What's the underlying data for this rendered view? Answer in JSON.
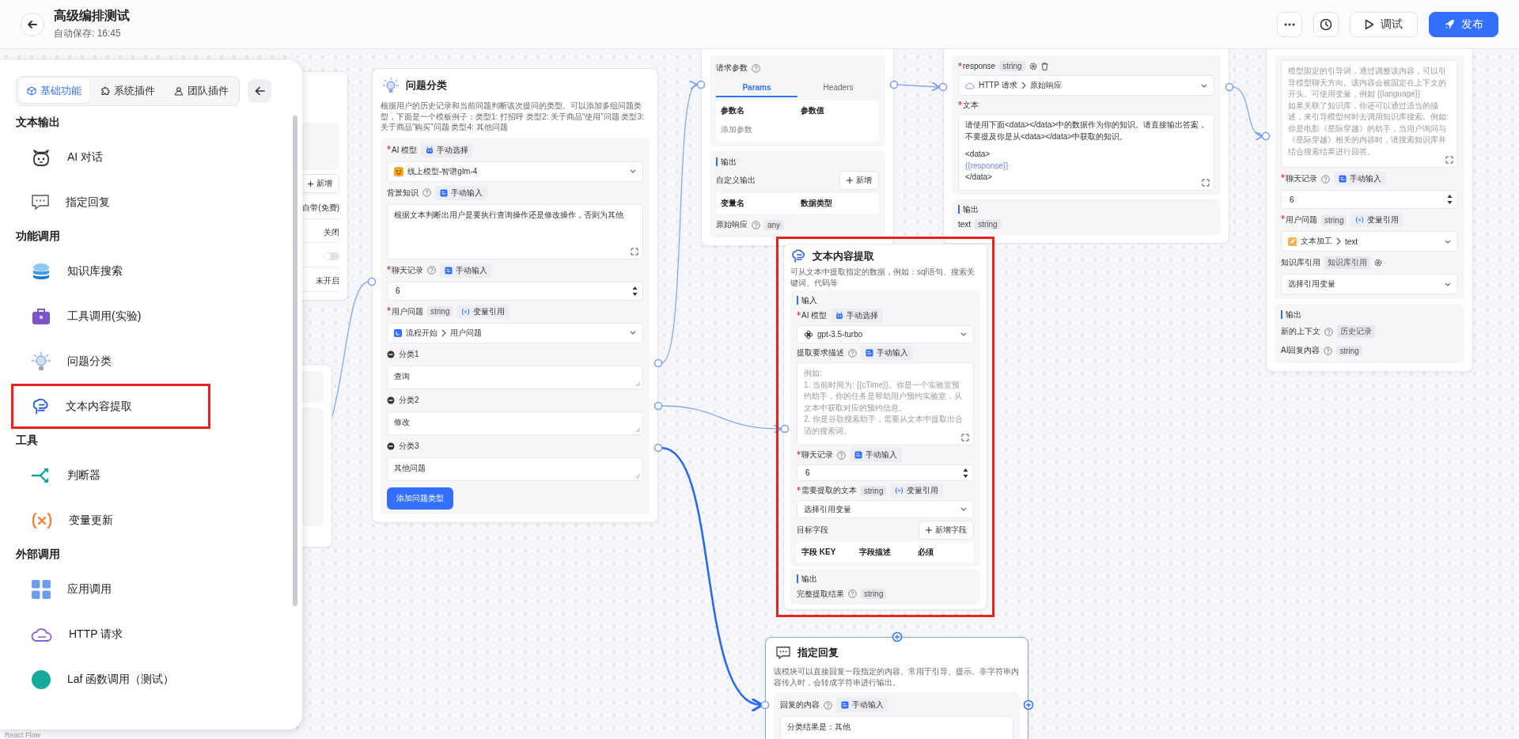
{
  "header": {
    "title": "高级编排测试",
    "autosave": "自动保存: 16:45",
    "buttons": [
      {
        "label": "调试",
        "kind": "outline"
      },
      {
        "label": "发布",
        "kind": "primary"
      }
    ]
  },
  "panel": {
    "tabs": [
      {
        "label": "基础功能",
        "selected": true
      },
      {
        "label": "系统插件",
        "selected": false
      },
      {
        "label": "团队插件",
        "selected": false
      }
    ],
    "groups": [
      {
        "title": "文本输出",
        "items": [
          {
            "label": "AI 对话",
            "annotated": false
          },
          {
            "label": "指定回复",
            "annotated": false
          }
        ]
      },
      {
        "title": "功能调用",
        "items": [
          {
            "label": "知识库搜索",
            "annotated": false
          },
          {
            "label": "工具调用(实验)",
            "annotated": false
          },
          {
            "label": "问题分类",
            "annotated": false
          },
          {
            "label": "文本内容提取",
            "annotated": true
          }
        ]
      },
      {
        "title": "工具",
        "items": [
          {
            "label": "判断器",
            "annotated": false
          },
          {
            "label": "变量更新",
            "annotated": false
          }
        ]
      },
      {
        "title": "外部调用",
        "items": [
          {
            "label": "应用调用",
            "annotated": false
          },
          {
            "label": "HTTP 请求",
            "annotated": false
          },
          {
            "label": "Laf 函数调用（测试）",
            "annotated": false
          }
        ]
      }
    ]
  },
  "hidden_node": {
    "rows": [
      {
        "kind": "add",
        "label": "新增"
      },
      {
        "kind": "value",
        "text": "自带(免费)"
      },
      {
        "kind": "value",
        "text": "关闭"
      },
      {
        "kind": "toggle",
        "on": false
      },
      {
        "kind": "value",
        "text": "未开启"
      }
    ]
  },
  "nodes": [
    {
      "title": "问题分类",
      "description": "根据用户的历史记录和当前问题判断该次提问的类型。可以添加多组问题类型，下面是一个模板例子：类型1: 打招呼 类型2: 关于商品“使用”问题 类型3: 关于商品“购买”问题 类型4: 其他问题",
      "selected": false,
      "annotated": false,
      "blocks": [
        {
          "rows": [
            {
              "kind": "label",
              "text": "AI 模型",
              "required": true,
              "help": false,
              "source": {
                "kind": "model",
                "label": "手动选择"
              }
            },
            {
              "kind": "select",
              "value": "线上模型-智谱glm-4"
            },
            {
              "kind": "label",
              "text": "背景知识",
              "required": false,
              "help": true,
              "source": {
                "kind": "manual",
                "label": "手动输入"
              }
            },
            {
              "kind": "textarea",
              "value": "根据文本判断出用户是要执行查询操作还是修改操作，否则为其他"
            },
            {
              "kind": "label",
              "text": "聊天记录",
              "required": true,
              "help": true,
              "source": {
                "kind": "manual",
                "label": "手动输入"
              }
            },
            {
              "kind": "number",
              "value": "6"
            },
            {
              "kind": "label",
              "text": "用户问题",
              "required": true,
              "help": false,
              "type": "string",
              "source": {
                "kind": "variable",
                "label": "变量引用"
              }
            },
            {
              "kind": "select",
              "parts": [
                "流程开始",
                "用户问题"
              ]
            },
            {
              "kind": "category",
              "label": "分类1",
              "value": "查询"
            },
            {
              "kind": "category",
              "label": "分类2",
              "value": "修改"
            },
            {
              "kind": "category",
              "label": "分类3",
              "value": "其他问题"
            },
            {
              "kind": "button",
              "label": "添加问题类型"
            }
          ]
        }
      ]
    },
    {
      "selected": false,
      "annotated": false,
      "blocks": [
        {
          "rows": [
            {
              "kind": "label",
              "text": "请求参数",
              "required": false,
              "help": true
            },
            {
              "kind": "tabs",
              "items": [
                {
                  "label": "Params",
                  "selected": true
                },
                {
                  "label": "Headers",
                  "selected": false
                }
              ]
            },
            {
              "kind": "table",
              "columns": [
                "参数名",
                "参数值"
              ],
              "empty": "添加参数"
            }
          ]
        },
        {
          "rows": [
            {
              "kind": "heading",
              "text": "输出"
            },
            {
              "kind": "action",
              "text": "自定义输出",
              "button": "新增"
            },
            {
              "kind": "table",
              "columns": [
                "变量名",
                "数据类型"
              ]
            },
            {
              "kind": "output",
              "name": "原始响应",
              "help": true,
              "type": "any"
            }
          ]
        }
      ]
    },
    {
      "selected": false,
      "annotated": false,
      "blocks": [
        {
          "rows": [
            {
              "kind": "label",
              "text": "response",
              "required": true,
              "help": false,
              "type": "string",
              "gear": true,
              "trash": true
            },
            {
              "kind": "select",
              "parts": [
                "HTTP 请求",
                "原始响应"
              ]
            },
            {
              "kind": "label",
              "text": "文本",
              "required": true,
              "help": false
            },
            {
              "kind": "textarea",
              "paragraphs": [
                {
                  "text": "请使用下面<data></data>中的数据作为你的知识。请直接输出答案，不要提及你是从<data></data>中获取的知识。",
                  "variable": false
                },
                {
                  "text": "<data>",
                  "variable": false
                },
                {
                  "text": "{{response}}",
                  "variable": true
                },
                {
                  "text": "</data>",
                  "variable": false
                }
              ]
            }
          ]
        },
        {
          "rows": [
            {
              "kind": "heading",
              "text": "输出"
            },
            {
              "kind": "output",
              "name": "text",
              "help": false,
              "type": "string"
            }
          ]
        }
      ]
    },
    {
      "selected": false,
      "annotated": false,
      "blocks": [
        {
          "rows": [
            {
              "kind": "textarea",
              "placeholder": "模型固定的引导词，通过调整该内容，可以引导模型聊天方向。该内容会被固定在上下文的开头。可使用变量，例如 {{language}}\n如果关联了知识库，你还可以通过适当的描述，来引导模型何时去调用知识库搜索。例如:\n你是电影《星际穿越》的助手，当用户询问与《星际穿越》相关的内容时，请搜索知识库并结合搜索结果进行回答。"
            },
            {
              "kind": "label",
              "text": "聊天记录",
              "required": true,
              "help": true,
              "source": {
                "kind": "manual",
                "label": "手动输入"
              }
            },
            {
              "kind": "number",
              "value": "6"
            },
            {
              "kind": "label",
              "text": "用户问题",
              "required": true,
              "help": false,
              "type": "string",
              "source": {
                "kind": "variable",
                "label": "变量引用"
              }
            },
            {
              "kind": "select",
              "parts": [
                "文本加工",
                "text"
              ]
            },
            {
              "kind": "label",
              "text": "知识库引用",
              "required": false,
              "help": false,
              "type": "知识库引用",
              "gear": true
            },
            {
              "kind": "select",
              "value": "选择引用变量"
            }
          ]
        },
        {
          "rows": [
            {
              "kind": "heading",
              "text": "输出"
            },
            {
              "kind": "output",
              "name": "新的上下文",
              "help": true,
              "type": "历史记录"
            },
            {
              "kind": "output",
              "name": "AI回复内容",
              "help": true,
              "type": "string"
            }
          ]
        }
      ]
    },
    {
      "title": "文本内容提取",
      "description": "可从文本中提取指定的数据，例如：sql语句、搜索关键词、代码等",
      "selected": false,
      "annotated": true,
      "blocks": [
        {
          "rows": [
            {
              "kind": "heading",
              "text": "输入"
            },
            {
              "kind": "label",
              "text": "AI 模型",
              "required": true,
              "help": false,
              "source": {
                "kind": "model",
                "label": "手动选择"
              }
            },
            {
              "kind": "select",
              "value": "gpt-3.5-turbo"
            },
            {
              "kind": "label",
              "text": "提取要求描述",
              "required": false,
              "help": true,
              "source": {
                "kind": "manual",
                "label": "手动输入"
              }
            },
            {
              "kind": "textarea",
              "placeholder": "例如:\n1. 当前时间为: {{cTime}}。你是一个实验室预约助手，你的任务是帮助用户预约实验室，从文本中获取对应的预约信息。\n2. 你是谷歌搜索助手，需要从文本中提取出合适的搜索词。"
            },
            {
              "kind": "label",
              "text": "聊天记录",
              "required": true,
              "help": true,
              "source": {
                "kind": "manual",
                "label": "手动输入"
              }
            },
            {
              "kind": "number",
              "value": "6"
            },
            {
              "kind": "label",
              "text": "需要提取的文本",
              "required": true,
              "help": false,
              "type": "string",
              "source": {
                "kind": "variable",
                "label": "变量引用"
              }
            },
            {
              "kind": "select",
              "value": "选择引用变量"
            },
            {
              "kind": "action",
              "text": "目标字段",
              "button": "新增字段"
            },
            {
              "kind": "table",
              "columns": [
                "字段 KEY",
                "字段描述",
                "必须"
              ]
            }
          ]
        },
        {
          "rows": [
            {
              "kind": "heading",
              "text": "输出"
            },
            {
              "kind": "output",
              "name": "完整提取结果",
              "help": true,
              "type": "string"
            }
          ]
        }
      ]
    },
    {
      "title": "指定回复",
      "description": "该模块可以直接回复一段指定的内容。常用于引导、提示。非字符串内容传入时，会转成字符串进行输出。",
      "selected": true,
      "annotated": false,
      "blocks": [
        {
          "rows": [
            {
              "kind": "label",
              "text": "回复的内容",
              "required": false,
              "help": true,
              "source": {
                "kind": "manual",
                "label": "手动输入"
              }
            },
            {
              "kind": "textarea",
              "value": "分类结果是：其他"
            }
          ]
        }
      ]
    }
  ],
  "attribution": "React Flow"
}
